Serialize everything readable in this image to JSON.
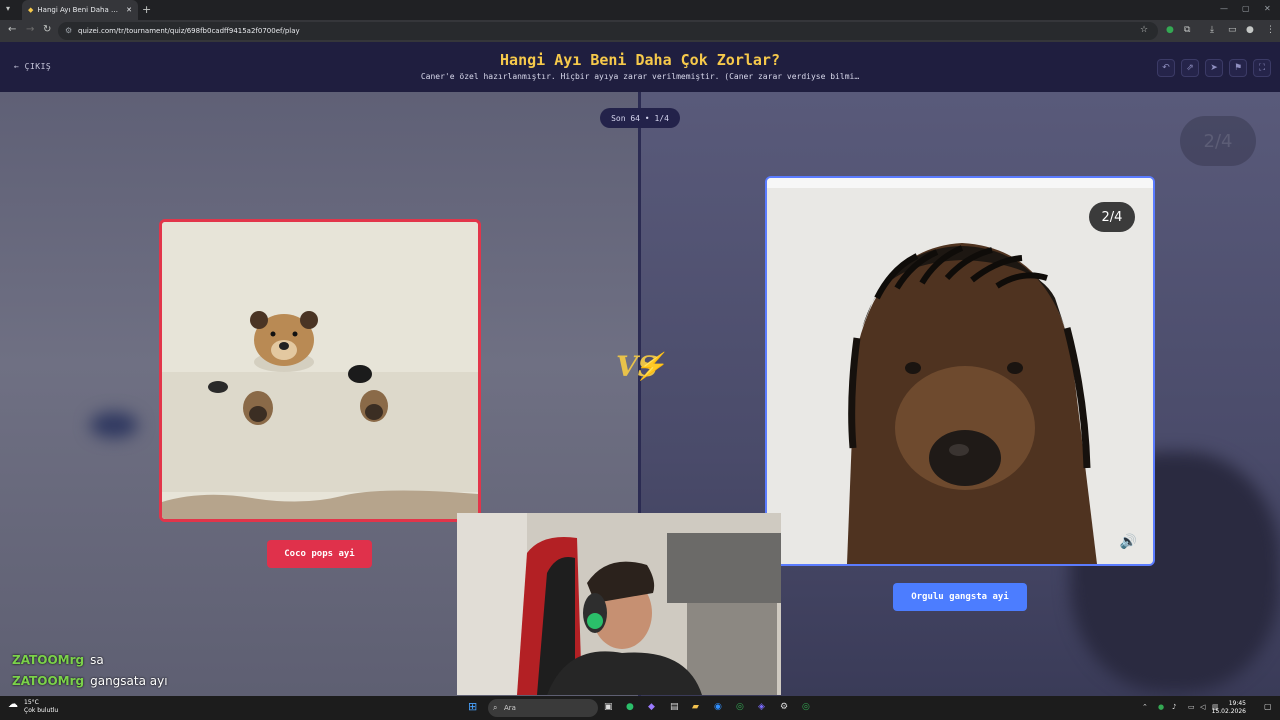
{
  "browser": {
    "tab_title": "Hangi Ayı Beni Daha Çok Zorla",
    "url": "quizei.com/tr/tournament/quiz/698fb0cadff9415a2f0700ef/play"
  },
  "header": {
    "exit_label": "ÇIKIŞ",
    "title": "Hangi Ayı Beni Daha Çok Zorlar?",
    "subtitle": "Caner'e özel hazırlanmıştır. Hiçbir ayıya zarar verilmemiştir. (Caner zarar verdiyse bilmi…"
  },
  "round": {
    "label": "Son 64 • 1/4"
  },
  "vs_label": "VS",
  "left_choice": {
    "name": "Coco pops ayi"
  },
  "right_choice": {
    "name": "Orgulu gangsta ayi",
    "counter": "2/4",
    "ghost_counter": "2/4"
  },
  "chat": [
    {
      "user": "ZATOOMrg",
      "message": "sa"
    },
    {
      "user": "ZATOOMrg",
      "message": "gangsata ayı"
    }
  ],
  "taskbar": {
    "temperature": "15°C",
    "weather": "Çok bulutlu",
    "search_placeholder": "Ara",
    "time": "19:45",
    "date": "15.02.2026"
  },
  "colors": {
    "accent_title": "#f6c94b",
    "left_red": "#e0314b",
    "right_blue": "#4c7dff"
  }
}
